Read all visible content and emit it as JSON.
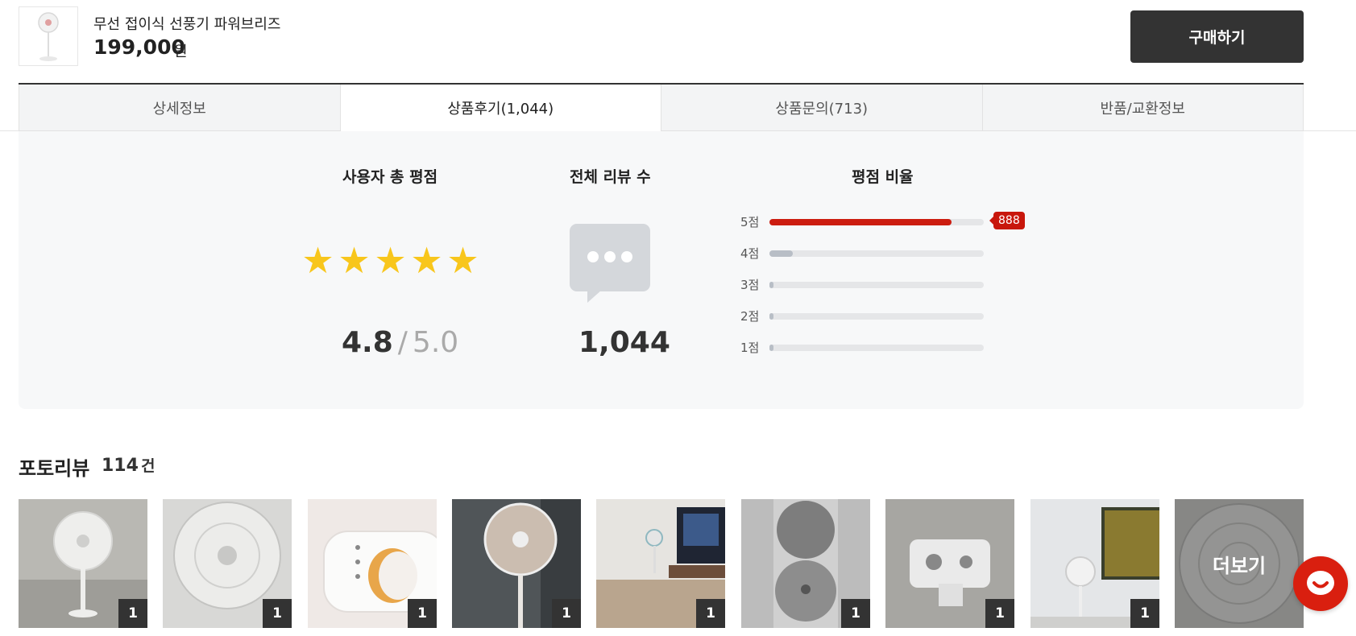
{
  "header": {
    "product_name": "무선 접이식 선풍기 파워브리즈",
    "price": "199,000",
    "price_unit": "원",
    "buy_button": "구매하기"
  },
  "tabs": [
    {
      "label": "상세정보",
      "active": false
    },
    {
      "label": "상품후기(1,044)",
      "active": true
    },
    {
      "label": "상품문의(713)",
      "active": false
    },
    {
      "label": "반품/교환정보",
      "active": false
    }
  ],
  "summary": {
    "rating_title": "사용자 총 평점",
    "review_count_title": "전체 리뷰 수",
    "ratio_title": "평점 비율",
    "stars": 5,
    "score": "4.8",
    "score_sep": "/",
    "score_max": "5.0",
    "review_count": "1,044",
    "ratings": [
      {
        "label": "5점",
        "fraction": 0.85,
        "count": "888"
      },
      {
        "label": "4점",
        "fraction": 0.11
      },
      {
        "label": "3점",
        "fraction": 0.02
      },
      {
        "label": "2점",
        "fraction": 0.005
      },
      {
        "label": "1점",
        "fraction": 0.01
      }
    ],
    "accent_color": "#cc1d10",
    "star_color": "#f8c61c"
  },
  "photo_reviews": {
    "title": "포토리뷰",
    "count": "114",
    "count_unit": "건",
    "items": [
      {
        "badge": "1"
      },
      {
        "badge": "1"
      },
      {
        "badge": "1"
      },
      {
        "badge": "1"
      },
      {
        "badge": "1"
      },
      {
        "badge": "1"
      },
      {
        "badge": "1"
      },
      {
        "badge": "1"
      }
    ],
    "more_label": "더보기"
  }
}
